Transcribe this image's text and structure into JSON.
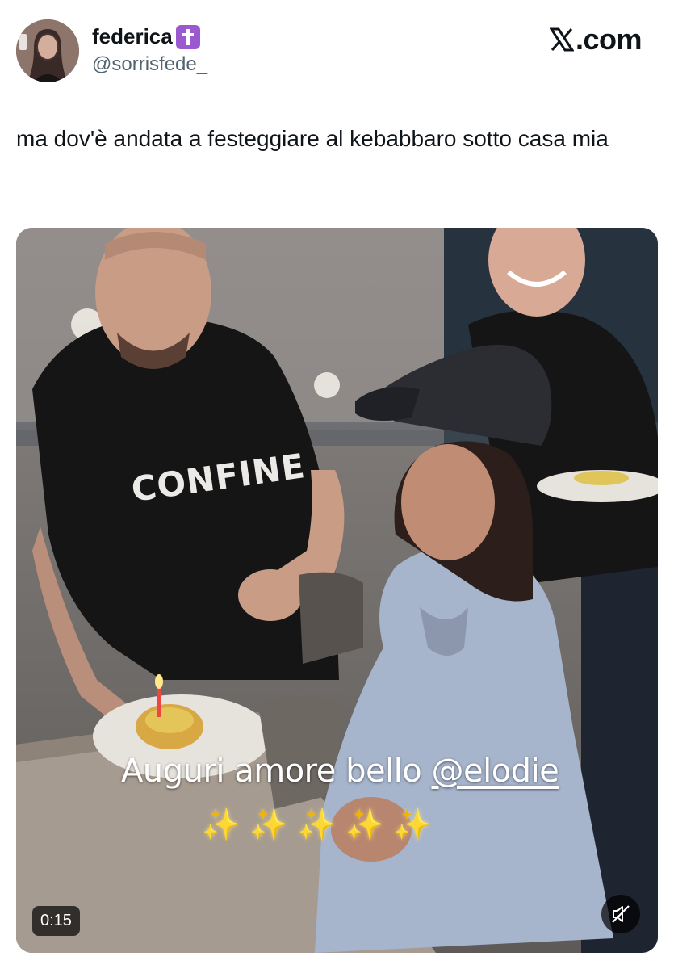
{
  "author": {
    "display_name": "federica",
    "name_emoji": "latin-cross-emoji",
    "handle": "@sorrisfede_"
  },
  "brand": {
    "label": ".com",
    "logo": "x-logo-icon"
  },
  "tweet": {
    "text": "ma dov'è andata a festeggiare al kebabbaro sotto casa mia"
  },
  "media": {
    "type": "video",
    "duration": "0:15",
    "mute_icon": "speaker-muted-icon",
    "overlay_caption_prefix": "Auguri amore bello ",
    "overlay_caption_mention": "@elodie",
    "overlay_sparkles": "✨✨✨✨✨",
    "shirt_text": "CONFINE"
  },
  "colors": {
    "emoji_badge": "#9b59d0",
    "text_primary": "#0f1419",
    "text_secondary": "#536471"
  }
}
